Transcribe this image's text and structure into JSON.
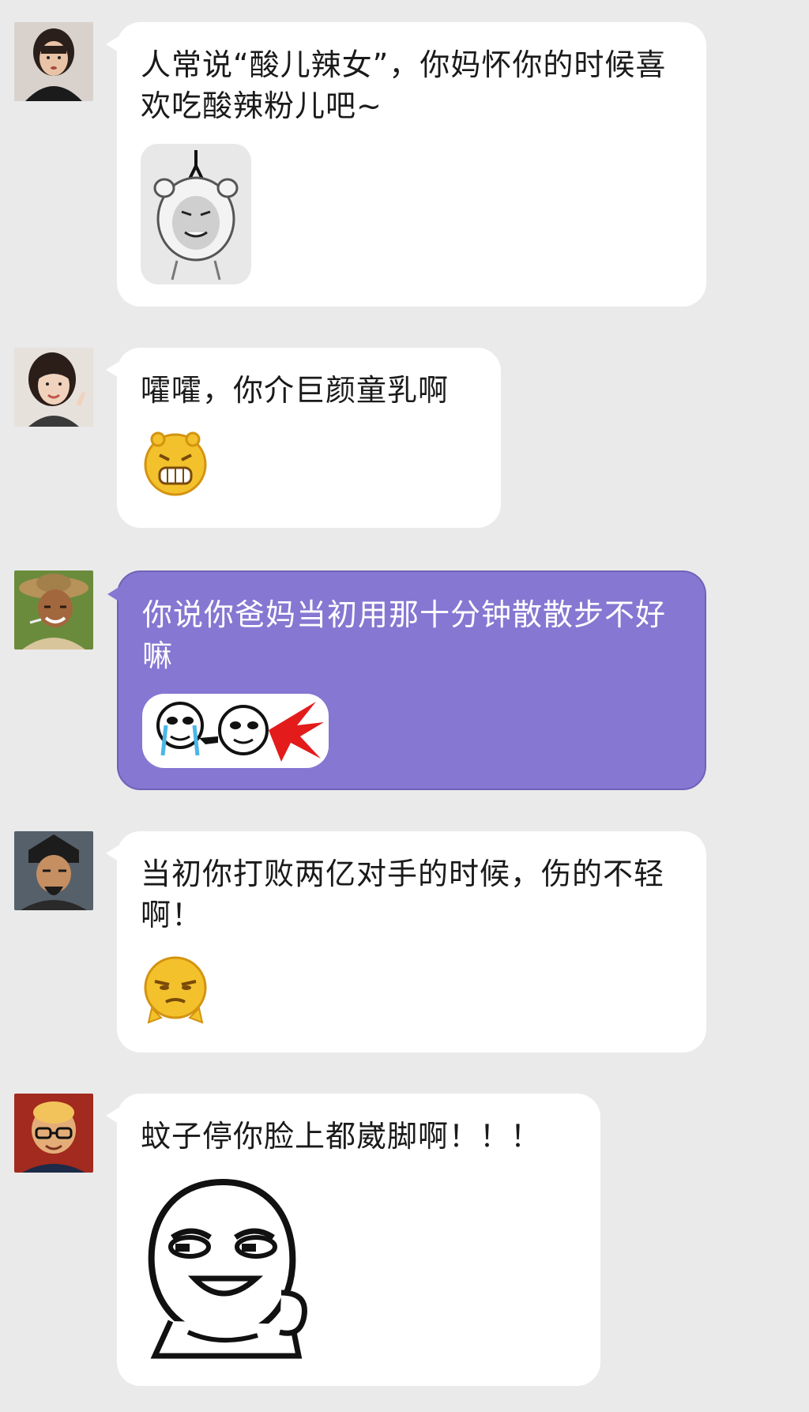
{
  "messages": [
    {
      "avatar_icon": "woman-avatar",
      "text": "人常说“酸儿辣女”，你妈怀你的时候喜欢吃酸辣粉儿吧~",
      "sticker_icon": "hanging-panda-sticker",
      "style": "white"
    },
    {
      "avatar_icon": "girl-avatar",
      "text": "嚯嚯，你介巨颜童乳啊",
      "sticker_icon": "laughing-emoji",
      "style": "white"
    },
    {
      "avatar_icon": "farmer-avatar",
      "text": "你说你爸妈当初用那十分钟散散步不好嘛",
      "sticker_icon": "gun-shooting-sticker",
      "style": "purple",
      "color": "#8677d2"
    },
    {
      "avatar_icon": "official-avatar",
      "text": "当初你打败两亿对手的时候，伤的不轻啊！",
      "sticker_icon": "smug-emoji",
      "style": "white"
    },
    {
      "avatar_icon": "man-glasses-avatar",
      "text": "蚊子停你脸上都崴脚啊！！！",
      "sticker_icon": "smug-face-sticker",
      "style": "white"
    }
  ]
}
